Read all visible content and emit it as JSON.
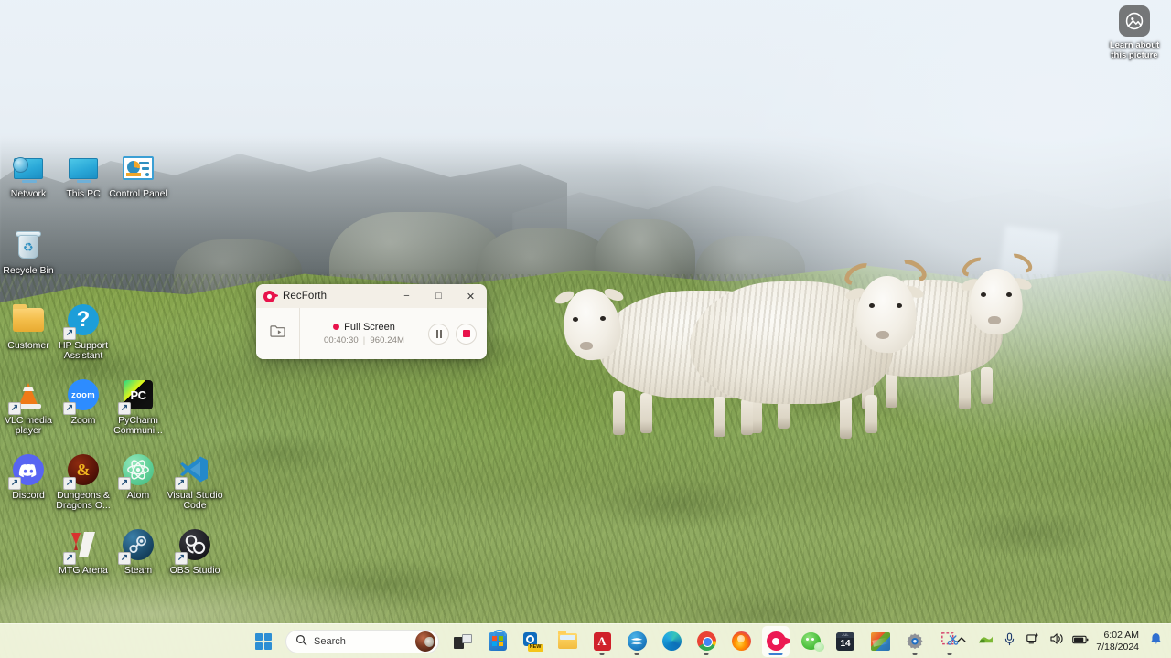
{
  "desktop": {
    "icons": [
      {
        "name": "Network",
        "icon": "network-icon",
        "shortcut": false
      },
      {
        "name": "This PC",
        "icon": "this-pc-icon",
        "shortcut": false
      },
      {
        "name": "Control Panel",
        "icon": "control-panel-icon",
        "shortcut": false
      },
      {
        "name": "Recycle Bin",
        "icon": "recycle-bin-icon",
        "shortcut": false
      },
      {
        "name": "Customer",
        "icon": "folder-icon",
        "shortcut": false
      },
      {
        "name": "HP Support Assistant",
        "icon": "hp-support-icon",
        "shortcut": true
      },
      {
        "name": "VLC media player",
        "icon": "vlc-icon",
        "shortcut": true
      },
      {
        "name": "Zoom",
        "icon": "zoom-icon",
        "shortcut": true
      },
      {
        "name": "PyCharm Communi...",
        "icon": "pycharm-icon",
        "shortcut": true
      },
      {
        "name": "Discord",
        "icon": "discord-icon",
        "shortcut": true
      },
      {
        "name": "Dungeons & Dragons O...",
        "icon": "dnd-icon",
        "shortcut": true
      },
      {
        "name": "Atom",
        "icon": "atom-icon",
        "shortcut": true
      },
      {
        "name": "Visual Studio Code",
        "icon": "vscode-icon",
        "shortcut": true
      },
      {
        "name": "MTG Arena",
        "icon": "mtg-arena-icon",
        "shortcut": true
      },
      {
        "name": "Steam",
        "icon": "steam-icon",
        "shortcut": true
      },
      {
        "name": "OBS Studio",
        "icon": "obs-studio-icon",
        "shortcut": true
      }
    ],
    "zoom_label": "zoom",
    "pycharm_label": "PC",
    "hp_glyph": "?",
    "dnd_glyph": "&",
    "recycle_glyph": "♻",
    "learn_picture": {
      "line1": "Learn about",
      "line2": "this picture",
      "icon": "picture-info-icon"
    }
  },
  "recforth": {
    "title": "RecForth",
    "app_icon": "recforth-camera-icon",
    "window_buttons": {
      "minimize": "−",
      "maximize": "□",
      "close": "✕"
    },
    "open_folder_icon": "open-folder-icon",
    "mode_label": "Full Screen",
    "elapsed": "00:40:30",
    "separator": "|",
    "size": "960.24M",
    "pause_icon": "pause-icon",
    "stop_icon": "stop-icon",
    "accent_color": "#e8134b"
  },
  "taskbar": {
    "start_icon": "windows-start-icon",
    "search": {
      "icon": "search-icon",
      "placeholder": "Search",
      "avatar_icon": "user-avatar-icon"
    },
    "items": [
      {
        "name": "Task View",
        "icon": "task-view-icon",
        "active": false,
        "running": false
      },
      {
        "name": "Microsoft Store",
        "icon": "microsoft-store-icon",
        "active": false,
        "running": false
      },
      {
        "name": "Outlook (new)",
        "icon": "outlook-new-icon",
        "active": false,
        "running": false
      },
      {
        "name": "File Explorer",
        "icon": "file-explorer-icon",
        "active": false,
        "running": false
      },
      {
        "name": "Adobe Acrobat",
        "icon": "adobe-acrobat-icon",
        "active": false,
        "running": true
      },
      {
        "name": "Blue App",
        "icon": "blue-app-icon",
        "active": false,
        "running": true
      },
      {
        "name": "Microsoft Edge",
        "icon": "edge-icon",
        "active": false,
        "running": false
      },
      {
        "name": "Google Chrome",
        "icon": "chrome-icon",
        "active": false,
        "running": true
      },
      {
        "name": "Firefox",
        "icon": "firefox-icon",
        "active": false,
        "running": false
      },
      {
        "name": "RecForth",
        "icon": "recforth-icon",
        "active": true,
        "running": true
      },
      {
        "name": "WeChat",
        "icon": "wechat-icon",
        "active": false,
        "running": false
      },
      {
        "name": "Calendar",
        "icon": "calendar-icon",
        "active": false,
        "running": false
      },
      {
        "name": "Color App",
        "icon": "color-app-icon",
        "active": false,
        "running": false
      },
      {
        "name": "Settings",
        "icon": "settings-gear-icon",
        "active": false,
        "running": true
      },
      {
        "name": "Snipping Tool",
        "icon": "snipping-tool-icon",
        "active": false,
        "running": true
      }
    ],
    "calendar_header": "JUL",
    "calendar_day": "14",
    "acrobat_glyph": "A",
    "tray": {
      "overflow_icon": "chevron-up-icon",
      "nvidia_icon": "nvidia-icon",
      "mic_icon": "microphone-icon",
      "network_icon": "network-tray-icon",
      "volume_icon": "volume-icon",
      "battery_icon": "battery-icon",
      "time": "6:02 AM",
      "date": "7/18/2024",
      "notification_icon": "notification-bell-icon"
    }
  }
}
